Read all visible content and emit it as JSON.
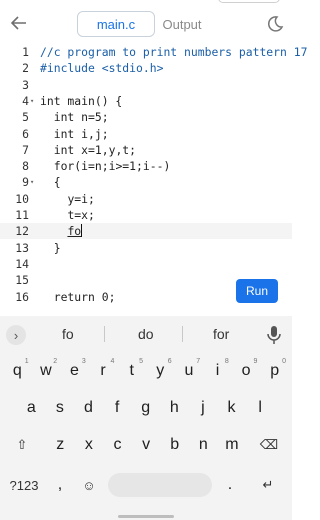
{
  "header": {
    "tabs": [
      "main.c",
      "Output"
    ],
    "active_tab": "main.c"
  },
  "editor": {
    "lines": [
      {
        "n": "1",
        "indent": 0,
        "text": "//c program to print numbers pattern 17",
        "kind": "comment"
      },
      {
        "n": "2",
        "indent": 0,
        "text": "#include <stdio.h>",
        "kind": "directive"
      },
      {
        "n": "3",
        "indent": 0,
        "text": "",
        "kind": "code"
      },
      {
        "n": "4",
        "indent": 0,
        "text": "int main() {",
        "kind": "code",
        "fold": true
      },
      {
        "n": "5",
        "indent": 2,
        "text": "int n=5;",
        "kind": "code"
      },
      {
        "n": "6",
        "indent": 2,
        "text": "int i,j;",
        "kind": "code"
      },
      {
        "n": "7",
        "indent": 2,
        "text": "int x=1,y,t;",
        "kind": "code"
      },
      {
        "n": "8",
        "indent": 2,
        "text": "for(i=n;i>=1;i--)",
        "kind": "code"
      },
      {
        "n": "9",
        "indent": 2,
        "text": "{",
        "kind": "code",
        "fold": true
      },
      {
        "n": "10",
        "indent": 4,
        "text": "y=i;",
        "kind": "code"
      },
      {
        "n": "11",
        "indent": 4,
        "text": "t=x;",
        "kind": "code"
      },
      {
        "n": "12",
        "indent": 4,
        "text": "fo",
        "kind": "cursor"
      },
      {
        "n": "13",
        "indent": 2,
        "text": "}",
        "kind": "code"
      },
      {
        "n": "14",
        "indent": 0,
        "text": "",
        "kind": "code"
      },
      {
        "n": "15",
        "indent": 0,
        "text": "",
        "kind": "code"
      },
      {
        "n": "16",
        "indent": 2,
        "text": "return 0;",
        "kind": "code"
      }
    ]
  },
  "run_button": {
    "label": "Run"
  },
  "keyboard": {
    "suggestions": [
      "fo",
      "do",
      "for"
    ],
    "rows": [
      [
        [
          "q",
          "1"
        ],
        [
          "w",
          "2"
        ],
        [
          "e",
          "3"
        ],
        [
          "r",
          "4"
        ],
        [
          "t",
          "5"
        ],
        [
          "y",
          "6"
        ],
        [
          "u",
          "7"
        ],
        [
          "i",
          "8"
        ],
        [
          "o",
          "9"
        ],
        [
          "p",
          "0"
        ]
      ],
      [
        [
          "a",
          ""
        ],
        [
          "s",
          ""
        ],
        [
          "d",
          ""
        ],
        [
          "f",
          ""
        ],
        [
          "g",
          ""
        ],
        [
          "h",
          ""
        ],
        [
          "j",
          ""
        ],
        [
          "k",
          ""
        ],
        [
          "l",
          ""
        ]
      ],
      [
        [
          "z",
          ""
        ],
        [
          "x",
          ""
        ],
        [
          "c",
          ""
        ],
        [
          "v",
          ""
        ],
        [
          "b",
          ""
        ],
        [
          "n",
          ""
        ],
        [
          "m",
          ""
        ]
      ]
    ],
    "shift_label": "⇧",
    "backspace_label": "⌫",
    "symbols_label": "?123",
    "comma_label": ",",
    "emoji_label": "☺",
    "period_label": ".",
    "enter_label": "↵"
  },
  "colors": {
    "accent": "#1a73e8",
    "comment": "#1b5fa8",
    "keyboard_bg": "#f3f3f3"
  }
}
